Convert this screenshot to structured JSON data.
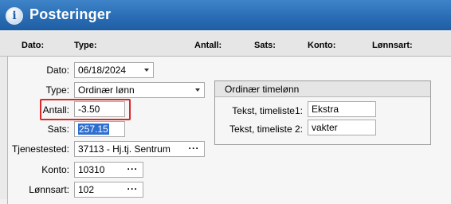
{
  "window": {
    "title": "Posteringer",
    "icon": "info-icon"
  },
  "columns": [
    "Dato:",
    "Type:",
    "Antall:",
    "Sats:",
    "Konto:",
    "Lønnsart:"
  ],
  "form": {
    "dato": {
      "label": "Dato:",
      "value": "06/18/2024"
    },
    "type": {
      "label": "Type:",
      "value": "Ordinær lønn"
    },
    "antall": {
      "label": "Antall:",
      "value": "-3.50"
    },
    "sats": {
      "label": "Sats:",
      "value": "257.15"
    },
    "tjenestested": {
      "label": "Tjenestested:",
      "value": "37113 - Hj.tj. Sentrum"
    },
    "konto": {
      "label": "Konto:",
      "value": "10310"
    },
    "lonnsart": {
      "label": "Lønnsart:",
      "value": "102"
    }
  },
  "group": {
    "title": "Ordinær timelønn",
    "tekst1": {
      "label": "Tekst, timeliste1:",
      "value": "Ekstra"
    },
    "tekst2": {
      "label": "Tekst, timeliste 2:",
      "value": "vakter"
    }
  },
  "colors": {
    "titlebar": "#2a6db5",
    "highlight": "#d9282a",
    "selection": "#2d6fd0"
  }
}
